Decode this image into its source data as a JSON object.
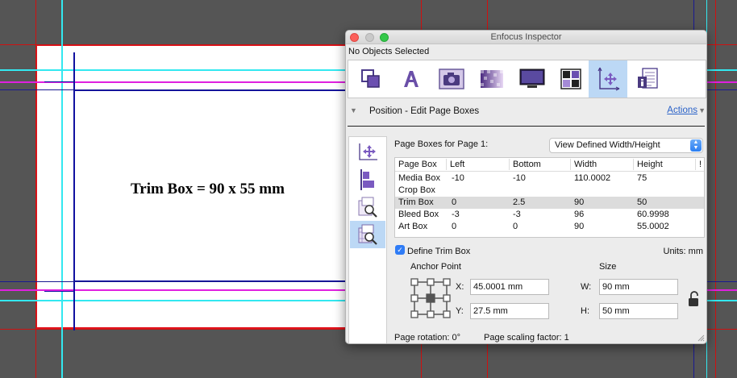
{
  "canvas": {
    "trim_label": "Trim Box = 90 x 55 mm"
  },
  "window": {
    "title": "Enfocus Inspector",
    "status": "No Objects Selected",
    "toolbar": [
      {
        "icon": "object-icon"
      },
      {
        "icon": "text-icon"
      },
      {
        "icon": "image-icon"
      },
      {
        "icon": "shading-icon"
      },
      {
        "icon": "monitor-icon"
      },
      {
        "icon": "color-grid-icon"
      },
      {
        "icon": "position-icon",
        "active": true
      },
      {
        "icon": "document-info-icon"
      }
    ]
  },
  "section": {
    "title": "Position - Edit Page Boxes",
    "actions_label": "Actions"
  },
  "panel": {
    "page_boxes_label": "Page Boxes for Page 1:",
    "view_select": "View Defined Width/Height",
    "table": {
      "headers": [
        "Page Box",
        "Left",
        "Bottom",
        "Width",
        "Height",
        "!"
      ],
      "rows": [
        {
          "box": "Media Box",
          "left": "-10",
          "bottom": "-10",
          "width": "110.0002",
          "height": "75",
          "selected": false
        },
        {
          "box": "Crop Box",
          "left": "",
          "bottom": "",
          "width": "",
          "height": "",
          "selected": false
        },
        {
          "box": "Trim Box",
          "left": "0",
          "bottom": "2.5",
          "width": "90",
          "height": "50",
          "selected": true
        },
        {
          "box": "Bleed Box",
          "left": "-3",
          "bottom": "-3",
          "width": "96",
          "height": "60.9998",
          "selected": false
        },
        {
          "box": "Art Box",
          "left": "0",
          "bottom": "0",
          "width": "90",
          "height": "55.0002",
          "selected": false
        }
      ]
    },
    "define_trim_label": "Define Trim Box",
    "define_trim_checked": true,
    "units_label": "Units: mm",
    "anchor_label": "Anchor Point",
    "size_label": "Size",
    "x_label": "X:",
    "x_value": "45.0001 mm",
    "y_label": "Y:",
    "y_value": "27.5 mm",
    "w_label": "W:",
    "w_value": "90 mm",
    "h_label": "H:",
    "h_value": "50 mm",
    "page_rotation": "Page rotation: 0°",
    "page_scaling": "Page scaling factor: 1"
  }
}
